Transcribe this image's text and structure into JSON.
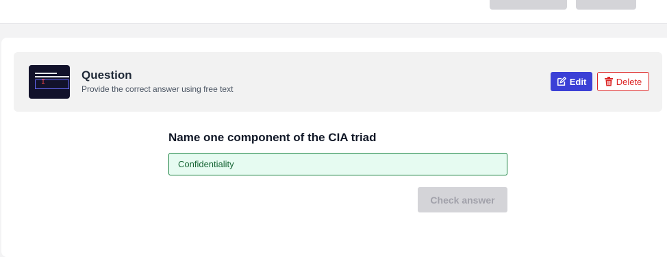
{
  "colors": {
    "accent": "#3b40d6",
    "danger": "#dc2626",
    "success_bg": "#e6fbf1",
    "success_border": "#15803d",
    "disabled_bg": "#d4d4d8"
  },
  "question_header": {
    "title": "Question",
    "subtitle": "Provide the correct answer using free text",
    "thumbnail_icon": "free-text-question-icon",
    "edit_label": "Edit",
    "edit_icon": "edit-icon",
    "delete_label": "Delete",
    "delete_icon": "trash-icon"
  },
  "question": {
    "prompt": "Name one component of the CIA triad",
    "answer_value": "Confidentiality",
    "check_label": "Check answer"
  }
}
